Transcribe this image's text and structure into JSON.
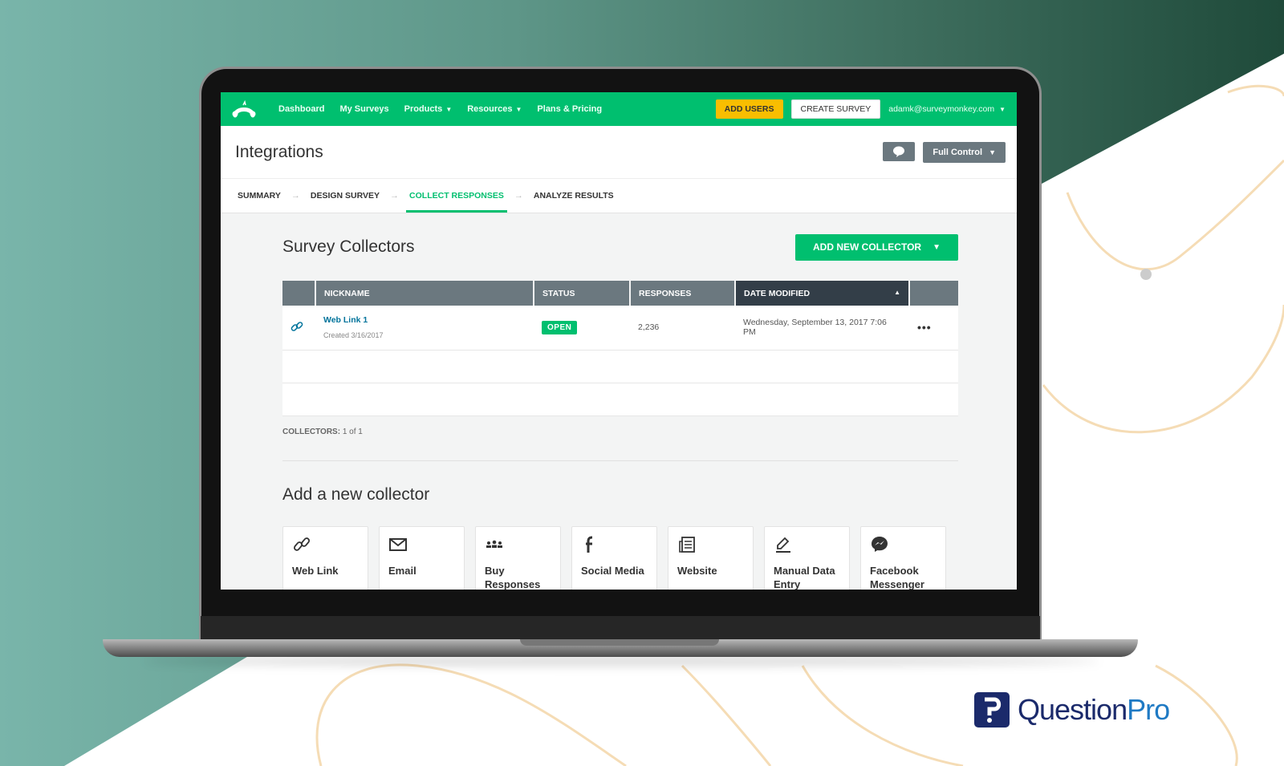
{
  "topnav": {
    "items": [
      {
        "label": "Dashboard",
        "has_caret": false
      },
      {
        "label": "My Surveys",
        "has_caret": false
      },
      {
        "label": "Products",
        "has_caret": true
      },
      {
        "label": "Resources",
        "has_caret": true
      },
      {
        "label": "Plans & Pricing",
        "has_caret": false
      }
    ],
    "add_users_label": "ADD USERS",
    "create_survey_label": "CREATE SURVEY",
    "account_email": "adamk@surveymonkey.com"
  },
  "header": {
    "title": "Integrations",
    "permission_label": "Full Control"
  },
  "steps": [
    {
      "label": "SUMMARY",
      "active": false
    },
    {
      "label": "DESIGN SURVEY",
      "active": false
    },
    {
      "label": "COLLECT RESPONSES",
      "active": true
    },
    {
      "label": "ANALYZE RESULTS",
      "active": false
    }
  ],
  "collectors": {
    "title": "Survey Collectors",
    "add_button_label": "ADD NEW COLLECTOR",
    "columns": [
      "NICKNAME",
      "STATUS",
      "RESPONSES",
      "DATE MODIFIED"
    ],
    "rows": [
      {
        "nickname": "Web Link 1",
        "created": "Created 3/16/2017",
        "status": "OPEN",
        "responses": "2,236",
        "date_modified": "Wednesday, September 13, 2017 7:06 PM"
      }
    ],
    "count_label": "COLLECTORS:",
    "count_value": "1 of 1"
  },
  "new_collector": {
    "title": "Add a new collector",
    "options": [
      {
        "label": "Web Link",
        "icon": "link-icon"
      },
      {
        "label": "Email",
        "icon": "envelope-icon"
      },
      {
        "label": "Buy Responses",
        "icon": "people-icon"
      },
      {
        "label": "Social Media",
        "icon": "facebook-icon"
      },
      {
        "label": "Website",
        "icon": "website-icon"
      },
      {
        "label": "Manual Data Entry",
        "icon": "pencil-icon"
      },
      {
        "label": "Facebook Messenger",
        "icon": "messenger-icon"
      }
    ]
  },
  "branding": {
    "logo_text_main": "Question",
    "logo_text_accent": "Pro"
  },
  "colors": {
    "brand_green": "#00bf6f",
    "add_users_yellow": "#f9be00",
    "header_gray": "#6b787f",
    "sorted_header": "#333e48",
    "link_blue": "#00739b",
    "questionpro_navy": "#1b2a6b"
  }
}
